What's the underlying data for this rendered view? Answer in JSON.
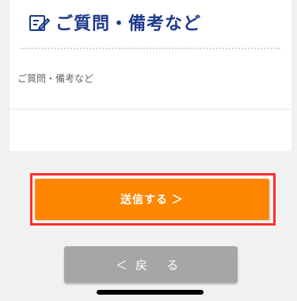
{
  "form": {
    "title": "ご質問・備考など",
    "title_icon": "edit-note-icon",
    "field_label": "ご質問・備考など",
    "textarea_value": ""
  },
  "actions": {
    "submit_label": "送信する ＞",
    "back_label": "＜戻 る"
  },
  "colors": {
    "title": "#1e3a8c",
    "submit_bg": "#ff8600",
    "submit_highlight": "#ff2d2d",
    "back_bg": "#a6a6a6"
  }
}
